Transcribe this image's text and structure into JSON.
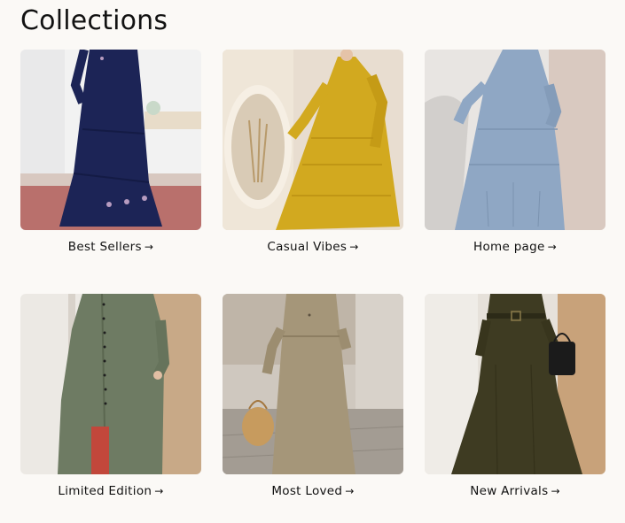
{
  "page": {
    "title": "Collections"
  },
  "collections": [
    {
      "label": "Best Sellers",
      "arrow": "→",
      "image_alt": "navy-tiered-maxi-dress"
    },
    {
      "label": "Casual Vibes",
      "arrow": "→",
      "image_alt": "mustard-tiered-maxi-dress"
    },
    {
      "label": "Home page",
      "arrow": "→",
      "image_alt": "light-blue-tiered-maxi-dress"
    },
    {
      "label": "Limited Edition",
      "arrow": "→",
      "image_alt": "sage-shirt-dress"
    },
    {
      "label": "Most Loved",
      "arrow": "→",
      "image_alt": "khaki-linen-dress"
    },
    {
      "label": "New Arrivals",
      "arrow": "→",
      "image_alt": "olive-belted-dress"
    }
  ],
  "colors": {
    "background": "#fbf9f6",
    "navy": "#1c2456",
    "mustard": "#d2a91f",
    "light_blue": "#8fa7c4",
    "sage": "#6e7b63",
    "khaki": "#a59679",
    "olive": "#3e3b22"
  }
}
